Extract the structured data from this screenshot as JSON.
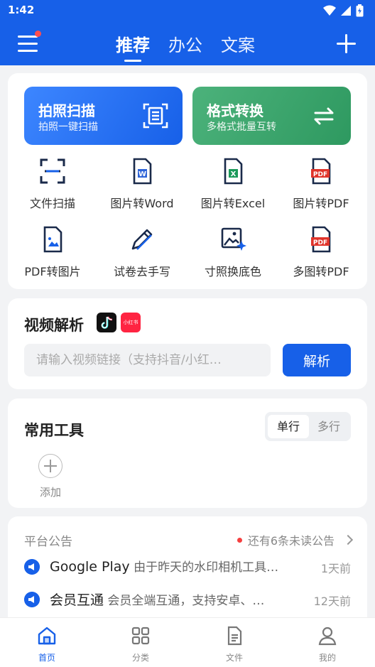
{
  "status_bar": {
    "time": "1:42"
  },
  "header": {
    "tabs": [
      {
        "label": "推荐",
        "active": true
      },
      {
        "label": "办公"
      },
      {
        "label": "文案"
      }
    ]
  },
  "feature_cards": [
    {
      "title": "拍照扫描",
      "subtitle": "拍照一键扫描",
      "icon": "document-scan-icon"
    },
    {
      "title": "格式转换",
      "subtitle": "多格式批量互转",
      "icon": "swap-arrows-icon"
    }
  ],
  "tools": [
    {
      "label": "文件扫描",
      "icon": "scan-frame-icon"
    },
    {
      "label": "图片转Word",
      "icon": "word-file-icon"
    },
    {
      "label": "图片转Excel",
      "icon": "excel-file-icon"
    },
    {
      "label": "图片转PDF",
      "icon": "pdf-file-icon"
    },
    {
      "label": "PDF转图片",
      "icon": "image-file-icon"
    },
    {
      "label": "试卷去手写",
      "icon": "pen-icon"
    },
    {
      "label": "寸照换底色",
      "icon": "photo-sparkle-icon"
    },
    {
      "label": "多图转PDF",
      "icon": "multi-pdf-icon"
    }
  ],
  "video": {
    "title": "视频解析",
    "xhs_label": "小红书",
    "placeholder": "请输入视频链接（支持抖音/小红…",
    "button": "解析"
  },
  "common_tools": {
    "title": "常用工具",
    "seg_single": "单行",
    "seg_multi": "多行",
    "add_label": "添加"
  },
  "notice": {
    "title": "平台公告",
    "unread": "还有6条未读公告",
    "items": [
      {
        "bold": "Google Play",
        "text": " 由于昨天的水印相机工具…",
        "time": "1天前"
      },
      {
        "bold": "会员互通",
        "text": " 会员全端互通，支持安卓、…",
        "time": "12天前"
      }
    ]
  },
  "bottom_nav": [
    {
      "label": "首页",
      "icon": "home-icon",
      "active": true
    },
    {
      "label": "分类",
      "icon": "grid-icon"
    },
    {
      "label": "文件",
      "icon": "file-icon"
    },
    {
      "label": "我的",
      "icon": "user-icon"
    }
  ],
  "colors": {
    "primary": "#1760e8",
    "green": "#2e9960",
    "pdf_red": "#e0342b",
    "word_blue": "#2e64d8",
    "excel_green": "#1d9a5b"
  }
}
